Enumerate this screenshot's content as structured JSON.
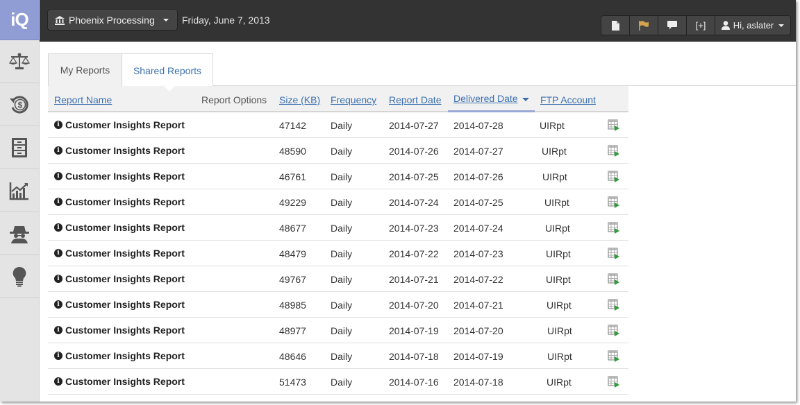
{
  "brand": {
    "logo_text": "iQ"
  },
  "sidebar": {
    "items": [
      {
        "icon": "scales-icon"
      },
      {
        "icon": "dollar-refresh-icon"
      },
      {
        "icon": "file-cabinet-icon"
      },
      {
        "icon": "line-chart-icon"
      },
      {
        "icon": "spy-icon"
      },
      {
        "icon": "lightbulb-icon"
      }
    ]
  },
  "topbar": {
    "env_label": "Phoenix Processing",
    "date": "Friday, June 7, 2013",
    "tools": {
      "brackets_label": "[+]",
      "user_label": "Hi, aslater"
    }
  },
  "tabs": [
    {
      "label": "My Reports",
      "active": false
    },
    {
      "label": "Shared Reports",
      "active": true
    }
  ],
  "table": {
    "headers": {
      "name": "Report Name",
      "options": "Report Options",
      "size": "Size (KB)",
      "frequency": "Frequency",
      "report_date": "Report Date",
      "delivered_date": "Delivered Date",
      "ftp": "FTP Account"
    },
    "rows": [
      {
        "name": "Customer Insights Report",
        "size": "47142",
        "frequency": "Daily",
        "report_date": "2014-07-27",
        "delivered_date": "2014-07-28",
        "ftp": "UIRpt"
      },
      {
        "name": "Customer Insights Report",
        "size": "48590",
        "frequency": "Daily",
        "report_date": "2014-07-26",
        "delivered_date": "2014-07-27",
        "ftp": "UIRpt"
      },
      {
        "name": "Customer Insights Report",
        "size": "46761",
        "frequency": "Daily",
        "report_date": "2014-07-25",
        "delivered_date": "2014-07-26",
        "ftp": "UIRpt"
      },
      {
        "name": "Customer Insights Report",
        "size": "49229",
        "frequency": "Daily",
        "report_date": "2014-07-24",
        "delivered_date": "2014-07-25",
        "ftp": "UIRpt"
      },
      {
        "name": "Customer Insights Report",
        "size": "48677",
        "frequency": "Daily",
        "report_date": "2014-07-23",
        "delivered_date": "2014-07-24",
        "ftp": "UIRpt"
      },
      {
        "name": "Customer Insights Report",
        "size": "48479",
        "frequency": "Daily",
        "report_date": "2014-07-22",
        "delivered_date": "2014-07-23",
        "ftp": "UIRpt"
      },
      {
        "name": "Customer Insights Report",
        "size": "49767",
        "frequency": "Daily",
        "report_date": "2014-07-21",
        "delivered_date": "2014-07-22",
        "ftp": "UIRpt"
      },
      {
        "name": "Customer Insights Report",
        "size": "48985",
        "frequency": "Daily",
        "report_date": "2014-07-20",
        "delivered_date": "2014-07-21",
        "ftp": "UIRpt"
      },
      {
        "name": "Customer Insights Report",
        "size": "48977",
        "frequency": "Daily",
        "report_date": "2014-07-19",
        "delivered_date": "2014-07-20",
        "ftp": "UIRpt"
      },
      {
        "name": "Customer Insights Report",
        "size": "48646",
        "frequency": "Daily",
        "report_date": "2014-07-18",
        "delivered_date": "2014-07-19",
        "ftp": "UIRpt"
      },
      {
        "name": "Customer Insights Report",
        "size": "51473",
        "frequency": "Daily",
        "report_date": "2014-07-16",
        "delivered_date": "2014-07-18",
        "ftp": "UIRpt"
      }
    ]
  },
  "colors": {
    "accent": "#3a6fb0",
    "topbar": "#333333",
    "logo_bg": "#8f9dd4"
  }
}
